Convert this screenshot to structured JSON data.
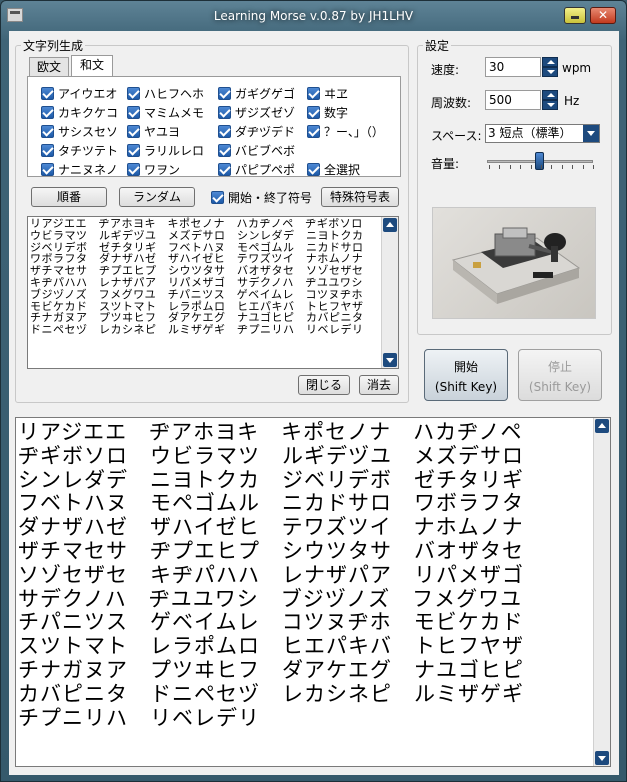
{
  "window": {
    "title": "Learning Morse v.0.87 by JH1LHV",
    "close_glyph": "✕"
  },
  "generate": {
    "group_label": "文字列生成",
    "tabs": [
      {
        "label": "欧文"
      },
      {
        "label": "和文"
      }
    ],
    "checkboxes": [
      {
        "label": "アイウエオ",
        "checked": true
      },
      {
        "label": "ハヒフヘホ",
        "checked": true
      },
      {
        "label": "ガギグゲゴ",
        "checked": true
      },
      {
        "label": "ヰヱ",
        "checked": true
      },
      {
        "label": "カキクケコ",
        "checked": true
      },
      {
        "label": "マミムメモ",
        "checked": true
      },
      {
        "label": "ザジズゼゾ",
        "checked": true
      },
      {
        "label": "数字",
        "checked": true
      },
      {
        "label": "サシスセソ",
        "checked": true
      },
      {
        "label": "ヤユヨ",
        "checked": true
      },
      {
        "label": "ダヂヅデド",
        "checked": true
      },
      {
        "label": "？ー、」（）",
        "checked": true
      },
      {
        "label": "タチツテト",
        "checked": true
      },
      {
        "label": "ラリルレロ",
        "checked": true
      },
      {
        "label": "バビブベボ",
        "checked": true
      },
      {
        "label": "ナニヌネノ",
        "checked": true
      },
      {
        "label": "ワヲン",
        "checked": true
      },
      {
        "label": "パピプペポ",
        "checked": true
      },
      {
        "label": "全選択",
        "checked": true
      }
    ],
    "order_button": "順番",
    "random_button": "ランダム",
    "start_end_checkbox": {
      "label": "開始・終了符号",
      "checked": true
    },
    "special_button": "特殊符号表",
    "small_text": "リアジエエ　ヂアホヨキ　キポセノナ　ハカヂノペ　ヂギボソロ\nウビラマツ　ルギデヅユ　メズデサロ　シンレダデ　ニヨトクカ\nジベリデボ　ゼチタリギ　フベトハヌ　モペゴムル　ニカドサロ\nワボラフタ　ダナザハゼ　ザハイゼヒ　テワズツイ　ナホムノナ\nザチマセサ　ヂプエヒプ　シウツタサ　バオザタセ　ソゾセザセ\nキヂパハハ　レナザパア　リパメザゴ　サデクノハ　ヂユユワシ\nブジヅノズ　フメグワユ　チパニツス　ゲベイムレ　コツヌヂホ\nモビケカド　スツトマト　レラポムロ　ヒエパキバ　トヒフヤザ\nチナガヌア　プツヰヒフ　ダアケエグ　ナユゴヒピ　カバピニタ\nドニペセヅ　レカシネピ　ルミザゲギ　ヂプニリハ　リベレデリ",
    "close_button": "閉じる",
    "clear_button": "消去"
  },
  "settings": {
    "group_label": "設定",
    "speed": {
      "label": "速度:",
      "value": "30",
      "unit": "wpm"
    },
    "frequency": {
      "label": "周波数:",
      "value": "500",
      "unit": "Hz"
    },
    "space": {
      "label": "スペース:",
      "selected": "3 短点（標準）"
    },
    "volume": {
      "label": "音量:",
      "level_fraction": 0.5
    }
  },
  "controls": {
    "start_button": {
      "label": "開始",
      "shortcut": "(Shift Key)"
    },
    "stop_button": {
      "label": "停止",
      "shortcut": "(Shift Key)"
    }
  },
  "output_text": "リアジエエ　ヂアホヨキ　キポセノナ　ハカヂノペ\nヂギボソロ　ウビラマツ　ルギデヅユ　メズデサロ\nシンレダデ　ニヨトクカ　ジベリデボ　ゼチタリギ\nフベトハヌ　モペゴムル　ニカドサロ　ワボラフタ\nダナザハゼ　ザハイゼヒ　テワズツイ　ナホムノナ\nザチマセサ　ヂプエヒプ　シウツタサ　バオザタセ\nソゾセザセ　キヂパハハ　レナザパア　リパメザゴ\nサデクノハ　ヂユユワシ　ブジヅノズ　フメグワユ\nチパニツス　ゲベイムレ　コツヌヂホ　モビケカド\nスツトマト　レラポムロ　ヒエパキバ　トヒフヤザ\nチナガヌア　プツヰヒフ　ダアケエグ　ナユゴヒピ\nカバピニタ　ドニペセヅ　レカシネピ　ルミザゲギ\nチプニリハ　リベレデリ"
}
